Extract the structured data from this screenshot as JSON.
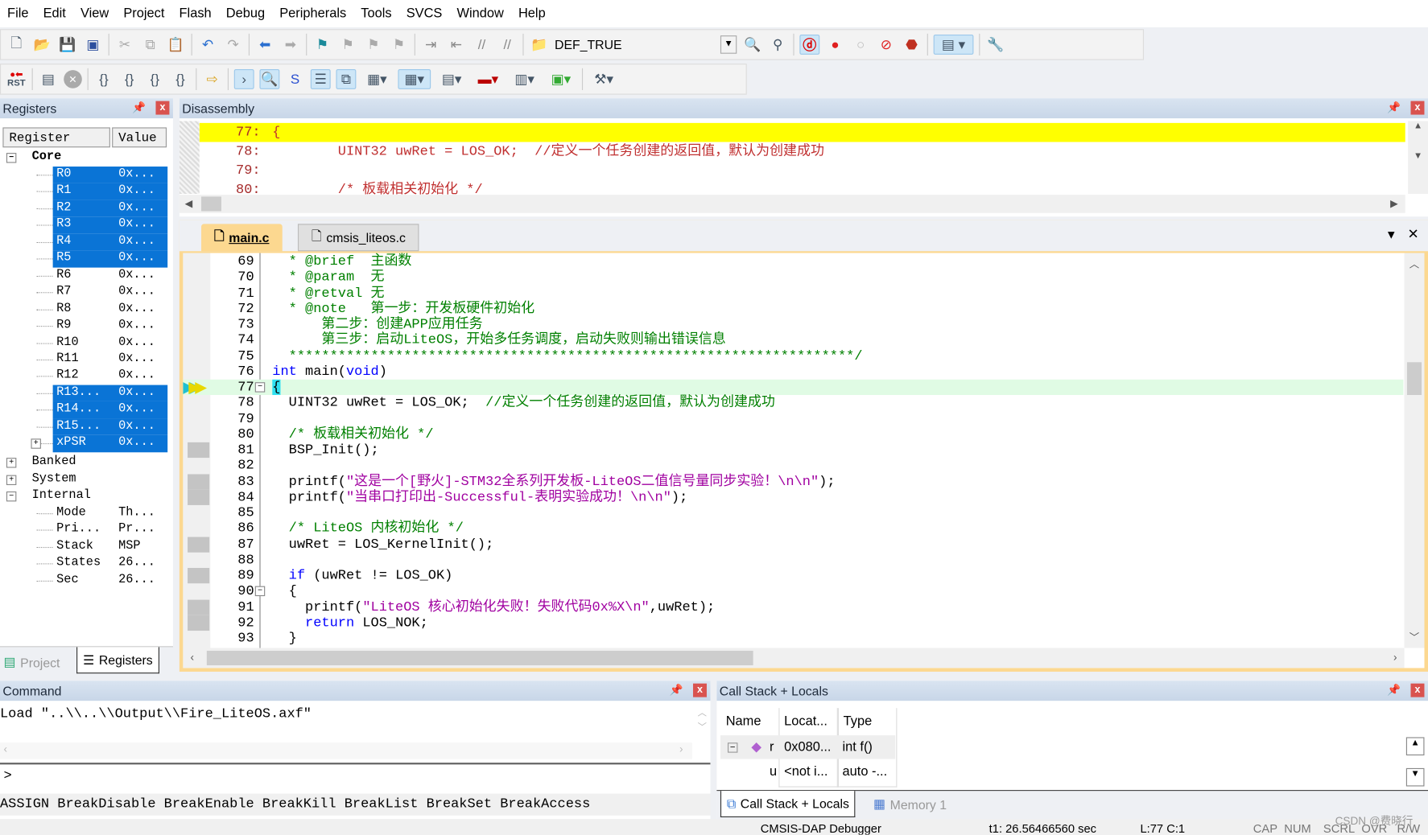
{
  "menu": [
    "File",
    "Edit",
    "View",
    "Project",
    "Flash",
    "Debug",
    "Peripherals",
    "Tools",
    "SVCS",
    "Window",
    "Help"
  ],
  "toolbar": {
    "target": "DEF_TRUE",
    "rst_label": "RST"
  },
  "registers": {
    "title": "Registers",
    "col_register": "Register",
    "col_value": "Value",
    "groups": {
      "core": "Core",
      "banked": "Banked",
      "system": "System",
      "internal": "Internal"
    },
    "core": [
      [
        "R0",
        "0x..."
      ],
      [
        "R1",
        "0x..."
      ],
      [
        "R2",
        "0x..."
      ],
      [
        "R3",
        "0x..."
      ],
      [
        "R4",
        "0x..."
      ],
      [
        "R5",
        "0x..."
      ],
      [
        "R6",
        "0x..."
      ],
      [
        "R7",
        "0x..."
      ],
      [
        "R8",
        "0x..."
      ],
      [
        "R9",
        "0x..."
      ],
      [
        "R10",
        "0x..."
      ],
      [
        "R11",
        "0x..."
      ],
      [
        "R12",
        "0x..."
      ],
      [
        "R13...",
        "0x..."
      ],
      [
        "R14...",
        "0x..."
      ],
      [
        "R15...",
        "0x..."
      ],
      [
        "xPSR",
        "0x..."
      ]
    ],
    "internal": [
      [
        "Mode",
        "Th..."
      ],
      [
        "Pri...",
        "Pr..."
      ],
      [
        "Stack",
        "MSP"
      ],
      [
        "States",
        "26..."
      ],
      [
        "Sec",
        "26..."
      ]
    ],
    "tabs": [
      "Project",
      "Registers"
    ]
  },
  "disassembly": {
    "title": "Disassembly",
    "lines": [
      [
        "77:",
        "{"
      ],
      [
        "78:",
        "        UINT32 uwRet = LOS_OK;  //定义一个任务创建的返回值，默认为创建成功"
      ],
      [
        "79:",
        ""
      ],
      [
        "80:",
        "        /* 板载相关初始化 */"
      ]
    ]
  },
  "editor": {
    "tabs": [
      "main.c",
      "cmsis_liteos.c"
    ],
    "lines": [
      [
        "69",
        "  * @brief  主函数",
        "cm"
      ],
      [
        "70",
        "  * @param  无",
        "cm"
      ],
      [
        "71",
        "  * @retval 无",
        "cm"
      ],
      [
        "72",
        "  * @note   第一步：开发板硬件初始化",
        "cm"
      ],
      [
        "73",
        "      第二步：创建APP应用任务",
        "cm"
      ],
      [
        "74",
        "      第三步：启动LiteOS，开始多任务调度，启动失败则输出错误信息",
        "cm"
      ],
      [
        "75",
        "  *********************************************************************/",
        "cm"
      ],
      [
        "76",
        "int main(void)",
        "kw"
      ],
      [
        "77",
        "{",
        ""
      ],
      [
        "78",
        "  UINT32 uwRet = LOS_OK;  //定义一个任务创建的返回值，默认为创建成功",
        ""
      ],
      [
        "79",
        "",
        ""
      ],
      [
        "80",
        "  /* 板载相关初始化 */",
        "cm"
      ],
      [
        "81",
        "  BSP_Init();",
        ""
      ],
      [
        "82",
        "",
        ""
      ],
      [
        "83",
        "  printf(\"这是一个[野火]-STM32全系列开发板-LiteOS二值信号量同步实验！\\n\\n\");",
        "st"
      ],
      [
        "84",
        "  printf(\"当串口打印出-Successful-表明实验成功！\\n\\n\");",
        "st"
      ],
      [
        "85",
        "",
        ""
      ],
      [
        "86",
        "  /* LiteOS 内核初始化 */",
        "cm"
      ],
      [
        "87",
        "  uwRet = LOS_KernelInit();",
        ""
      ],
      [
        "88",
        "",
        ""
      ],
      [
        "89",
        "  if (uwRet != LOS_OK)",
        "kw"
      ],
      [
        "90",
        "  {",
        ""
      ],
      [
        "91",
        "    printf(\"LiteOS 核心初始化失败！失败代码0x%X\\n\",uwRet);",
        "st"
      ],
      [
        "92",
        "    return LOS_NOK;",
        "kw"
      ],
      [
        "93",
        "  }",
        ""
      ]
    ]
  },
  "command": {
    "title": "Command",
    "output": "Load \"..\\\\..\\\\Output\\\\Fire_LiteOS.axf\"",
    "prompt": ">",
    "hints": "ASSIGN BreakDisable BreakEnable BreakKill BreakList BreakSet BreakAccess"
  },
  "callstack": {
    "title": "Call Stack + Locals",
    "cols": [
      "Name",
      "Locat...",
      "Type"
    ],
    "rows": [
      [
        "r",
        "0x080...",
        "int f()"
      ],
      [
        "u",
        "<not i...",
        "auto -..."
      ]
    ],
    "tabs": [
      "Call Stack + Locals",
      "Memory 1"
    ]
  },
  "status": {
    "debugger": "CMSIS-DAP Debugger",
    "time": "t1: 26.56466560 sec",
    "pos": "L:77 C:1",
    "flags": [
      "CAP",
      "NUM",
      "SCRL",
      "OVR",
      "R/W"
    ],
    "watermark": "CSDN @费晓行"
  },
  "colors": {
    "selection": "#0a74d6",
    "current_line": "#ffff00",
    "exec_line": "#e0fbe4",
    "comment": "#008000",
    "keyword": "#0000ff",
    "string": "#a000a0"
  }
}
